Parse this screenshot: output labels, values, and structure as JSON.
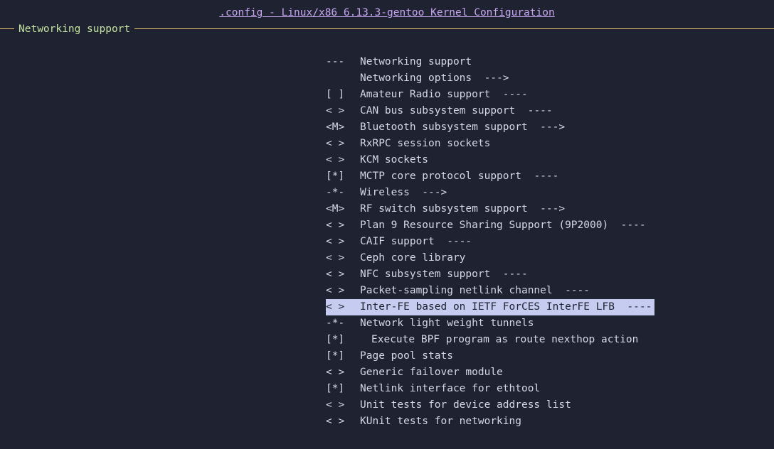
{
  "window": {
    "title": ".config - Linux/x86 6.13.3-gentoo Kernel Configuration"
  },
  "frame": {
    "title": "Networking support"
  },
  "menu": {
    "items": [
      {
        "mark": "--- ",
        "label": "Networking support",
        "suffix": ""
      },
      {
        "mark": "",
        "label": "Networking options",
        "suffix": "  --->"
      },
      {
        "mark": "[ ]",
        "label": "Amateur Radio support",
        "suffix": "  ----"
      },
      {
        "mark": "< >",
        "label": "CAN bus subsystem support",
        "suffix": "  ----"
      },
      {
        "mark": "<M>",
        "label": "Bluetooth subsystem support",
        "suffix": "  --->"
      },
      {
        "mark": "< >",
        "label": "RxRPC session sockets",
        "suffix": ""
      },
      {
        "mark": "< >",
        "label": "KCM sockets",
        "suffix": ""
      },
      {
        "mark": "[*]",
        "label": "MCTP core protocol support",
        "suffix": "  ----"
      },
      {
        "mark": "-*-",
        "label": "Wireless",
        "suffix": "  --->"
      },
      {
        "mark": "<M>",
        "label": "RF switch subsystem support",
        "suffix": "  --->"
      },
      {
        "mark": "< >",
        "label": "Plan 9 Resource Sharing Support (9P2000)",
        "suffix": "  ----"
      },
      {
        "mark": "< >",
        "label": "CAIF support",
        "suffix": "  ----"
      },
      {
        "mark": "< >",
        "label": "Ceph core library",
        "suffix": ""
      },
      {
        "mark": "< >",
        "label": "NFC subsystem support",
        "suffix": "  ----"
      },
      {
        "mark": "< >",
        "label": "Packet-sampling netlink channel",
        "suffix": "  ----"
      },
      {
        "mark": "< >",
        "label": "Inter-FE based on IETF ForCES InterFE LFB",
        "suffix": "  ----",
        "selected": true
      },
      {
        "mark": "-*-",
        "label": "Network light weight tunnels",
        "suffix": ""
      },
      {
        "mark": "[*]",
        "label": "Execute BPF program as route nexthop action",
        "suffix": "",
        "indent": true
      },
      {
        "mark": "[*]",
        "label": "Page pool stats",
        "suffix": ""
      },
      {
        "mark": "< >",
        "label": "Generic failover module",
        "suffix": ""
      },
      {
        "mark": "[*]",
        "label": "Netlink interface for ethtool",
        "suffix": ""
      },
      {
        "mark": "< >",
        "label": "Unit tests for device address list",
        "suffix": ""
      },
      {
        "mark": "< >",
        "label": "KUnit tests for networking",
        "suffix": ""
      }
    ]
  },
  "colors": {
    "background": "#1f2230",
    "title": "#c7a6f0",
    "frame_line": "#e5c56e",
    "frame_title": "#c4e3a1",
    "text": "#d3d8e6",
    "selection": "#c5ccf0"
  }
}
